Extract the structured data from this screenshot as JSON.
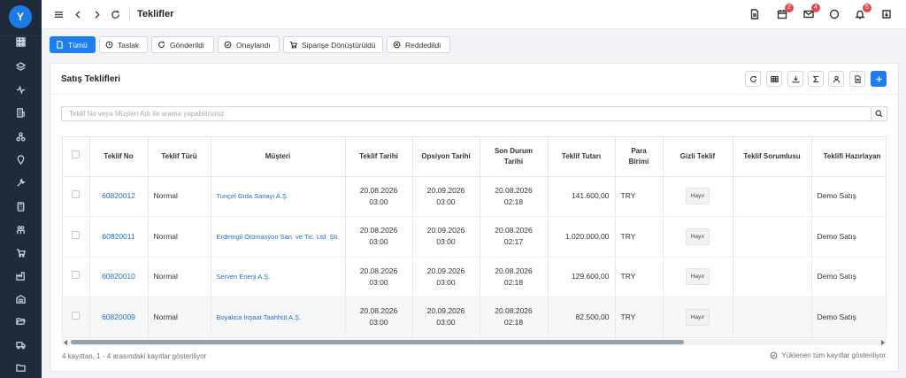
{
  "user": {
    "avatar_initial": "Y"
  },
  "sidebar": {
    "items": [
      {
        "icon": "grid-icon"
      },
      {
        "icon": "layers-icon"
      },
      {
        "icon": "activity-icon"
      },
      {
        "icon": "building-icon"
      },
      {
        "icon": "network-icon"
      },
      {
        "icon": "location-pin-icon"
      },
      {
        "icon": "wrench-icon"
      },
      {
        "icon": "calculator-icon"
      },
      {
        "icon": "people-icon"
      },
      {
        "icon": "cart-icon"
      },
      {
        "icon": "factory-icon"
      },
      {
        "icon": "warehouse-icon"
      },
      {
        "icon": "folder-open-icon"
      },
      {
        "icon": "truck-icon"
      },
      {
        "icon": "folder-icon"
      }
    ]
  },
  "topbar": {
    "title": "Teklifler",
    "right_icons": [
      {
        "icon": "document-icon",
        "badge": ""
      },
      {
        "icon": "calendar-icon",
        "badge": "2"
      },
      {
        "icon": "mail-icon",
        "badge": "4"
      },
      {
        "icon": "chat-icon",
        "badge": ""
      },
      {
        "icon": "bell-icon",
        "badge": "5"
      },
      {
        "icon": "logout-icon",
        "badge": ""
      }
    ]
  },
  "tabs": [
    {
      "label": "Tümü",
      "icon": "document-icon",
      "active": true
    },
    {
      "label": "Taslak",
      "icon": "clock-icon",
      "active": false
    },
    {
      "label": "Gönderildi",
      "icon": "refresh-icon",
      "active": false
    },
    {
      "label": "Onaylandı",
      "icon": "check-circle-icon",
      "active": false
    },
    {
      "label": "Siparişe Dönüştürüldü",
      "icon": "cart-icon",
      "active": false
    },
    {
      "label": "Reddedildi",
      "icon": "x-circle-icon",
      "active": false
    }
  ],
  "card": {
    "title": "Satış Teklifleri",
    "toolbar": [
      "refresh-icon",
      "columns-icon",
      "download-icon",
      "sigma-icon",
      "user-icon",
      "pdf-icon",
      "plus-icon"
    ]
  },
  "search": {
    "placeholder": "Teklif No veya Müşteri Adı ile arama yapabilirsiniz"
  },
  "table": {
    "headers": {
      "no": "Teklif No",
      "type": "Teklif Türü",
      "customer": "Müşteri",
      "date": "Teklif Tarihi",
      "option": "Opsiyon Tarihi",
      "status_line1": "Son Durum",
      "status_line2": "Tarihi",
      "amount": "Teklif Tutarı",
      "currency_line1": "Para",
      "currency_line2": "Birimi",
      "hidden": "Gizli Teklif",
      "owner": "Teklif Sorumlusu",
      "preparer": "Teklifi Hazırlayan"
    },
    "rows": [
      {
        "no": "60820012",
        "type": "Normal",
        "customer": "Tunçel Gıda Sanayi A.Ş.",
        "date": "20.08.2026",
        "date_time": "03:00",
        "option": "20.09.2026",
        "option_time": "03:00",
        "status": "20.08.2026",
        "status_time": "02:18",
        "amount": "141.600,00",
        "currency": "TRY",
        "hidden": "Hayır",
        "owner": "",
        "preparer": "Demo Satış"
      },
      {
        "no": "60820011",
        "type": "Normal",
        "customer": "Erdemgil Otomasyon San. ve Tic. Ltd. Şti.",
        "date": "20.08.2026",
        "date_time": "03:00",
        "option": "20.09.2026",
        "option_time": "03:00",
        "status": "20.08.2026",
        "status_time": "02:17",
        "amount": "1.020.000,00",
        "currency": "TRY",
        "hidden": "Hayır",
        "owner": "",
        "preparer": "Demo Satış"
      },
      {
        "no": "60820010",
        "type": "Normal",
        "customer": "Serven Enerji A.Ş.",
        "date": "20.08.2026",
        "date_time": "03:00",
        "option": "20.09.2026",
        "option_time": "03:00",
        "status": "20.08.2026",
        "status_time": "02:18",
        "amount": "129.600,00",
        "currency": "TRY",
        "hidden": "Hayır",
        "owner": "",
        "preparer": "Demo Satış"
      },
      {
        "no": "60820009",
        "type": "Normal",
        "customer": "Boyalıca İnşaat Taahhüt A.Ş.",
        "date": "20.08.2026",
        "date_time": "03:00",
        "option": "20.09.2026",
        "option_time": "03:00",
        "status": "20.08.2026",
        "status_time": "02:18",
        "amount": "82.500,00",
        "currency": "TRY",
        "hidden": "Hayır",
        "owner": "",
        "preparer": "Demo Satış"
      }
    ]
  },
  "footer": {
    "info": "4 kayıttan, 1 - 4 arasındaki kayıtlar gösteriliyor",
    "loaded": "Yüklenen tüm kayıtlar gösteriliyor."
  }
}
